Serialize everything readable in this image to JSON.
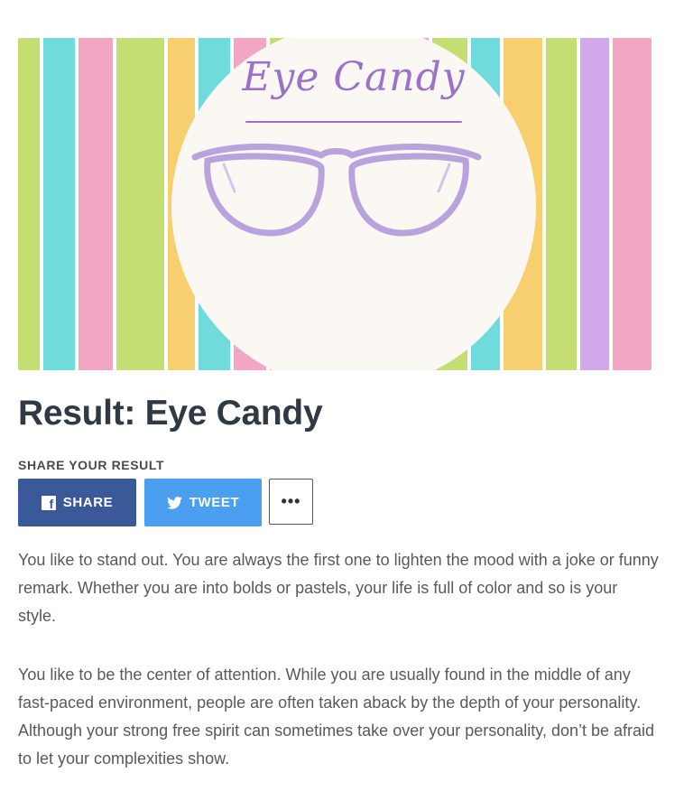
{
  "hero": {
    "title": "Eye Candy",
    "stripe_colors": [
      "#c4de72",
      "#6fdbdc",
      "#f3a6c3",
      "#c4de72",
      "#f8cf6e",
      "#6fdbdc",
      "#f3a6c3",
      "#c4de72",
      "#d3a8ea",
      "#f8cf6e",
      "#6fdbdc",
      "#f3a6c3",
      "#c4de72",
      "#6fdbdc",
      "#f8cf6e",
      "#c4de72",
      "#d3a8ea",
      "#f3a6c3"
    ],
    "frame_color": "#b9a3dd"
  },
  "result": {
    "title": "Result: Eye Candy"
  },
  "share": {
    "label": "SHARE YOUR RESULT",
    "facebook_label": "SHARE",
    "facebook_icon": "facebook-icon",
    "twitter_label": "TWEET",
    "twitter_icon": "twitter-bird-icon",
    "more_label": "•••",
    "colors": {
      "facebook": "#3b5998",
      "twitter": "#4a9ff0"
    }
  },
  "description": {
    "paragraph_1": "You like to stand out. You are always the first one to lighten the mood with a joke or funny remark. Whether you are into bolds or pastels, your life is full of color and so is your style.",
    "paragraph_2": "You like to be the center of attention. While you are usually found in the middle of any fast-paced environment, people are often taken aback by the depth of your personality. Although your strong free spirit can sometimes take over your personality, don’t be afraid to let your complexities show."
  }
}
